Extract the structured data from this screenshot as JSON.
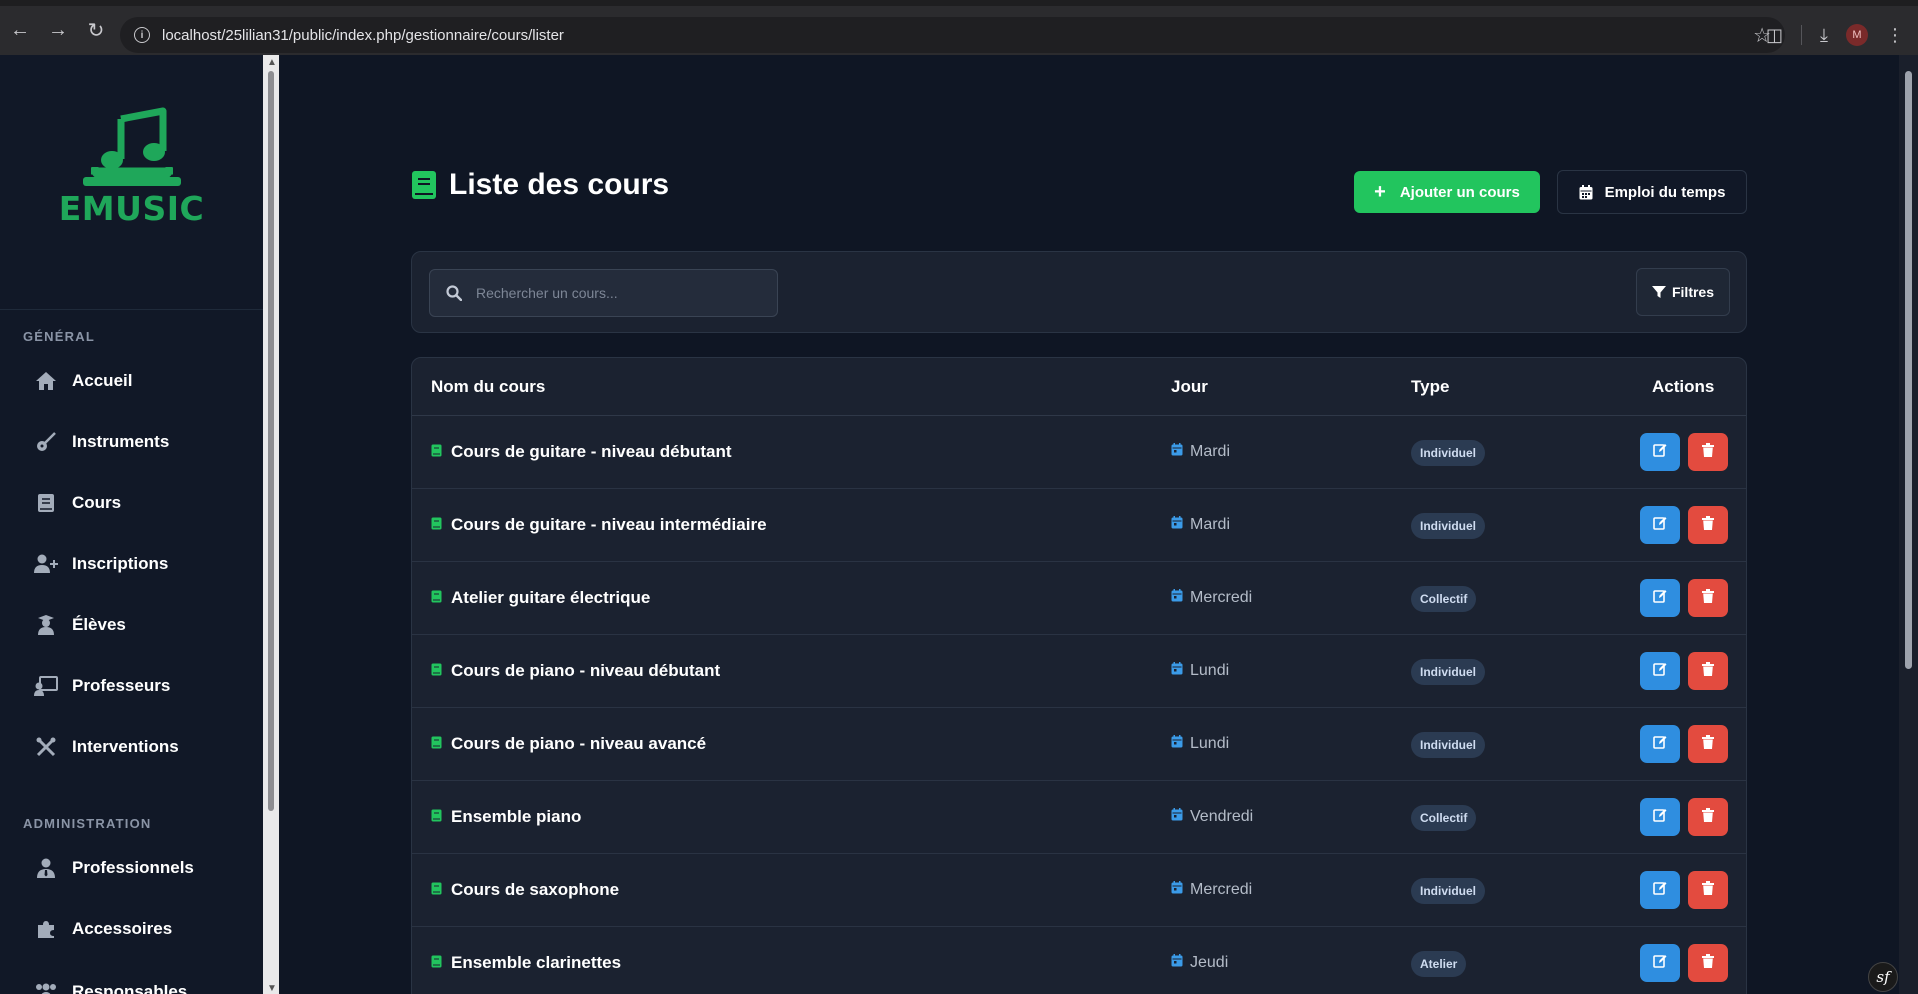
{
  "browser": {
    "url": "localhost/25lilian31/public/index.php/gestionnaire/cours/lister",
    "profile_initial": "M"
  },
  "sidebar": {
    "logo_text": "EMUSIC",
    "sections": [
      {
        "label": "GÉNÉRAL",
        "items": [
          {
            "label": "Accueil",
            "icon": "home-icon"
          },
          {
            "label": "Instruments",
            "icon": "guitar-icon"
          },
          {
            "label": "Cours",
            "icon": "book-icon"
          },
          {
            "label": "Inscriptions",
            "icon": "user-plus-icon"
          },
          {
            "label": "Élèves",
            "icon": "student-icon"
          },
          {
            "label": "Professeurs",
            "icon": "teacher-icon"
          },
          {
            "label": "Interventions",
            "icon": "tools-icon"
          }
        ]
      },
      {
        "label": "ADMINISTRATION",
        "items": [
          {
            "label": "Professionnels",
            "icon": "user-tie-icon"
          },
          {
            "label": "Accessoires",
            "icon": "puzzle-icon"
          },
          {
            "label": "Responsables",
            "icon": "users-icon"
          }
        ]
      }
    ]
  },
  "page": {
    "title": "Liste des cours",
    "add_button": "Ajouter un cours",
    "schedule_button": "Emploi du temps",
    "search_placeholder": "Rechercher un cours...",
    "filter_button": "Filtres"
  },
  "table": {
    "headers": {
      "name": "Nom du cours",
      "day": "Jour",
      "type": "Type",
      "actions": "Actions"
    },
    "rows": [
      {
        "name": "Cours de guitare - niveau débutant",
        "day": "Mardi",
        "type": "Individuel"
      },
      {
        "name": "Cours de guitare - niveau intermédiaire",
        "day": "Mardi",
        "type": "Individuel"
      },
      {
        "name": "Atelier guitare électrique",
        "day": "Mercredi",
        "type": "Collectif"
      },
      {
        "name": "Cours de piano - niveau débutant",
        "day": "Lundi",
        "type": "Individuel"
      },
      {
        "name": "Cours de piano - niveau avancé",
        "day": "Lundi",
        "type": "Individuel"
      },
      {
        "name": "Ensemble piano",
        "day": "Vendredi",
        "type": "Collectif"
      },
      {
        "name": "Cours de saxophone",
        "day": "Mercredi",
        "type": "Individuel"
      },
      {
        "name": "Ensemble clarinettes",
        "day": "Jeudi",
        "type": "Atelier"
      }
    ]
  },
  "colors": {
    "accent_green": "#22c55e",
    "edit_blue": "#2f8ee0",
    "delete_red": "#e34b3f",
    "day_icon_blue": "#3b9be8"
  }
}
